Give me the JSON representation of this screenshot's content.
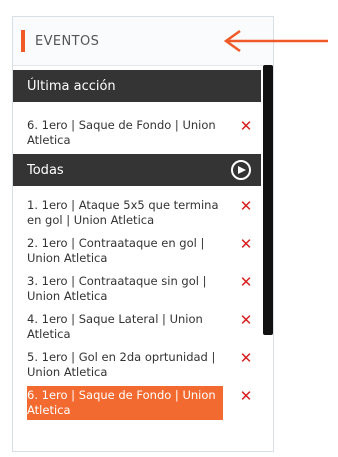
{
  "panel": {
    "title": "EVENTOS"
  },
  "last_action": {
    "header": "Última acción",
    "item": "6. 1ero | Saque de Fondo | Union Atletica"
  },
  "all": {
    "header": "Todas",
    "items": [
      {
        "text": "1. 1ero | Ataque 5x5 que termina en gol | Union Atletica"
      },
      {
        "text": "2. 1ero | Contraataque en gol | Union Atletica"
      },
      {
        "text": "3. 1ero | Contraataque sin gol | Union Atletica"
      },
      {
        "text": "4. 1ero | Saque Lateral | Union Atletica"
      },
      {
        "text": "5. 1ero | Gol en 2da oprtunidad | Union Atletica"
      },
      {
        "text": "6. 1ero | Saque de Fondo | Union Atletica"
      }
    ]
  },
  "icons": {
    "delete": "x-icon",
    "play": "play-circle-icon",
    "annotation": "arrow-left-icon"
  },
  "colors": {
    "accent": "#f05a28",
    "highlight": "#f26a2f",
    "section_bar": "#343434",
    "delete_icon": "#d81f1f"
  }
}
